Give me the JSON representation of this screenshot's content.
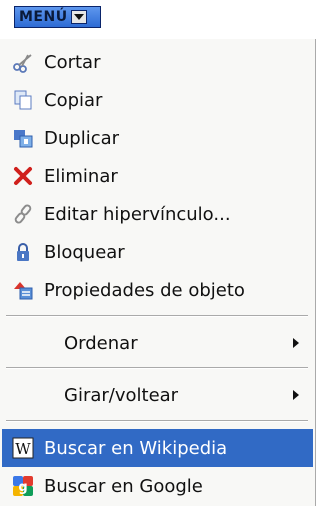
{
  "menu_button": {
    "label": "MENÚ"
  },
  "items": [
    {
      "label": "Cortar",
      "icon": "scissors-icon"
    },
    {
      "label": "Copiar",
      "icon": "copy-icon"
    },
    {
      "label": "Duplicar",
      "icon": "duplicate-icon"
    },
    {
      "label": "Eliminar",
      "icon": "delete-x-icon"
    },
    {
      "label": "Editar hipervínculo...",
      "icon": "link-chain-icon"
    },
    {
      "label": "Bloquear",
      "icon": "padlock-icon"
    },
    {
      "label": "Propiedades de objeto",
      "icon": "object-properties-icon"
    },
    {
      "label": "Ordenar",
      "submenu": true
    },
    {
      "label": "Girar/voltear",
      "submenu": true
    },
    {
      "label": "Buscar en Wikipedia",
      "icon": "wikipedia-icon",
      "selected": true
    },
    {
      "label": "Buscar en Google",
      "icon": "google-icon"
    }
  ],
  "colors": {
    "highlight": "#316ac5",
    "menu_button": "#2d6bd4"
  }
}
